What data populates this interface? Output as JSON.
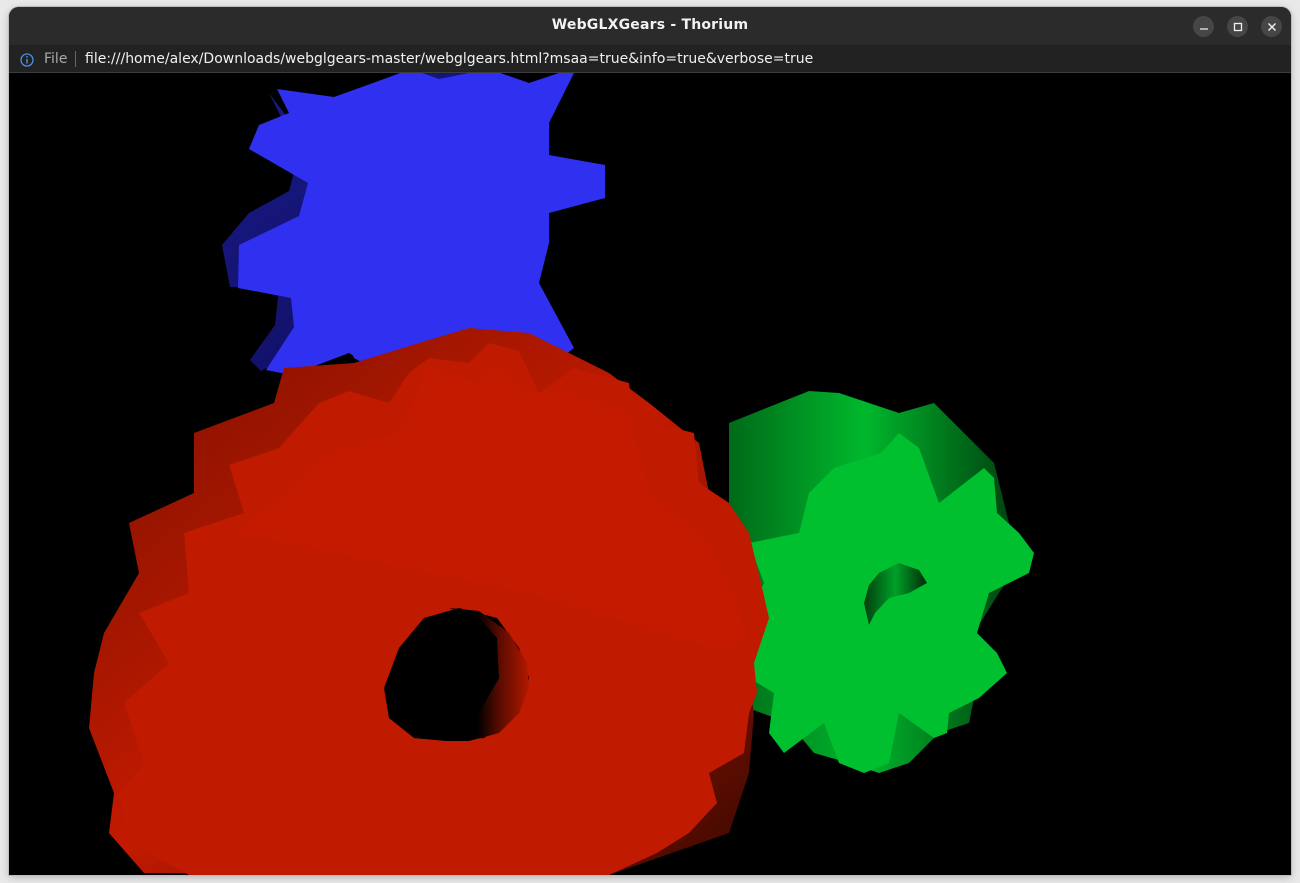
{
  "window": {
    "title": "WebGLXGears - Thorium"
  },
  "window_controls": {
    "minimize_icon": "minimize-icon",
    "maximize_icon": "maximize-icon",
    "close_icon": "close-icon"
  },
  "address_bar": {
    "security_icon": "info-icon",
    "scheme_label": "File",
    "url": "file:///home/alex/Downloads/webglgears-master/webglgears.html?msaa=true&info=true&verbose=true"
  },
  "scene": {
    "background_color": "#000000",
    "gears": [
      {
        "id": "red",
        "color": "#c21a00",
        "shade_color": "#6b0f00"
      },
      {
        "id": "green",
        "color": "#00c22f",
        "shade_color": "#006b1a"
      },
      {
        "id": "blue",
        "color": "#3333f0",
        "shade_color": "#1a1a8a"
      }
    ]
  }
}
